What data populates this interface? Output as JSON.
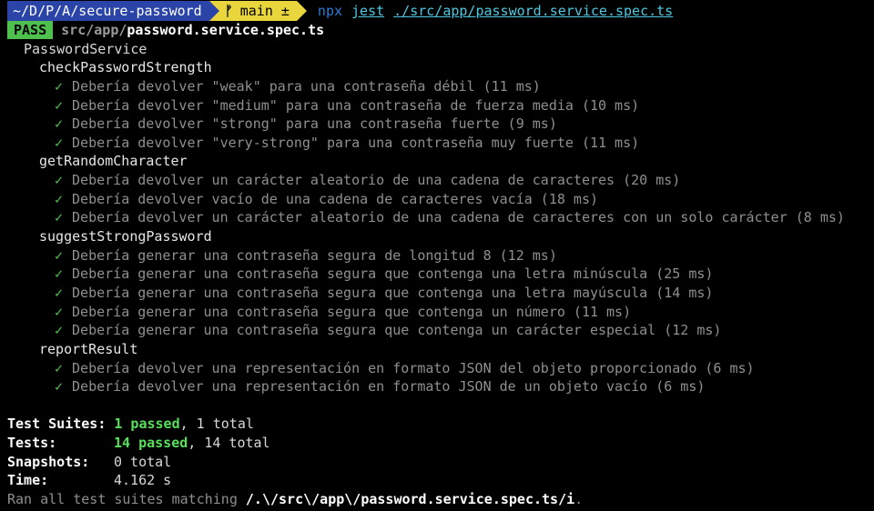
{
  "prompt": {
    "path": "~/D/P/A/secure-password",
    "branch_icon": "ᚠ",
    "branch": "main ±",
    "command": "npx",
    "program": "jest",
    "argument": "./src/app/password.service.spec.ts"
  },
  "result": {
    "badge": "PASS",
    "file_dir": "src/app/",
    "file_name": "password.service.spec.ts",
    "suite": "PasswordService"
  },
  "groups": [
    {
      "name": "checkPasswordStrength",
      "tests": [
        "Debería devolver \"weak\" para una contraseña débil (11 ms)",
        "Debería devolver \"medium\" para una contraseña de fuerza media (10 ms)",
        "Debería devolver \"strong\" para una contraseña fuerte (9 ms)",
        "Debería devolver \"very-strong\" para una contraseña muy fuerte (11 ms)"
      ]
    },
    {
      "name": "getRandomCharacter",
      "tests": [
        "Debería devolver un carácter aleatorio de una cadena de caracteres (20 ms)",
        "Debería devolver vacío de una cadena de caracteres vacía (18 ms)",
        "Debería devolver un carácter aleatorio de una cadena de caracteres con un solo carácter (8 ms)"
      ]
    },
    {
      "name": "suggestStrongPassword",
      "tests": [
        "Debería generar una contraseña segura de longitud 8 (12 ms)",
        "Debería generar una contraseña segura que contenga una letra minúscula (25 ms)",
        "Debería generar una contraseña segura que contenga una letra mayúscula (14 ms)",
        "Debería generar una contraseña segura que contenga un número (11 ms)",
        "Debería generar una contraseña segura que contenga un carácter especial (12 ms)"
      ]
    },
    {
      "name": "reportResult",
      "tests": [
        "Debería devolver una representación en formato JSON del objeto proporcionado (6 ms)",
        "Debería devolver una representación en formato JSON de un objeto vacío (6 ms)"
      ]
    }
  ],
  "check_glyph": "✓",
  "summary": {
    "suites_label": "Test Suites:",
    "suites_passed": "1 passed",
    "suites_total": ", 1 total",
    "tests_label": "Tests:",
    "tests_passed": "14 passed",
    "tests_total": ", 14 total",
    "snapshots_label": "Snapshots:",
    "snapshots_value": "0 total",
    "time_label": "Time:",
    "time_value": "4.162 s",
    "ran_text": "Ran all test suites matching ",
    "ran_pattern": "/.\\/src\\/app\\/password.service.spec.ts/i",
    "ran_end": "."
  },
  "colors": {
    "background": "#000000",
    "pass": "#4ec04e",
    "path_segment": "#2a44a8",
    "git_segment": "#e8d63c",
    "link": "#4ec8e0"
  }
}
